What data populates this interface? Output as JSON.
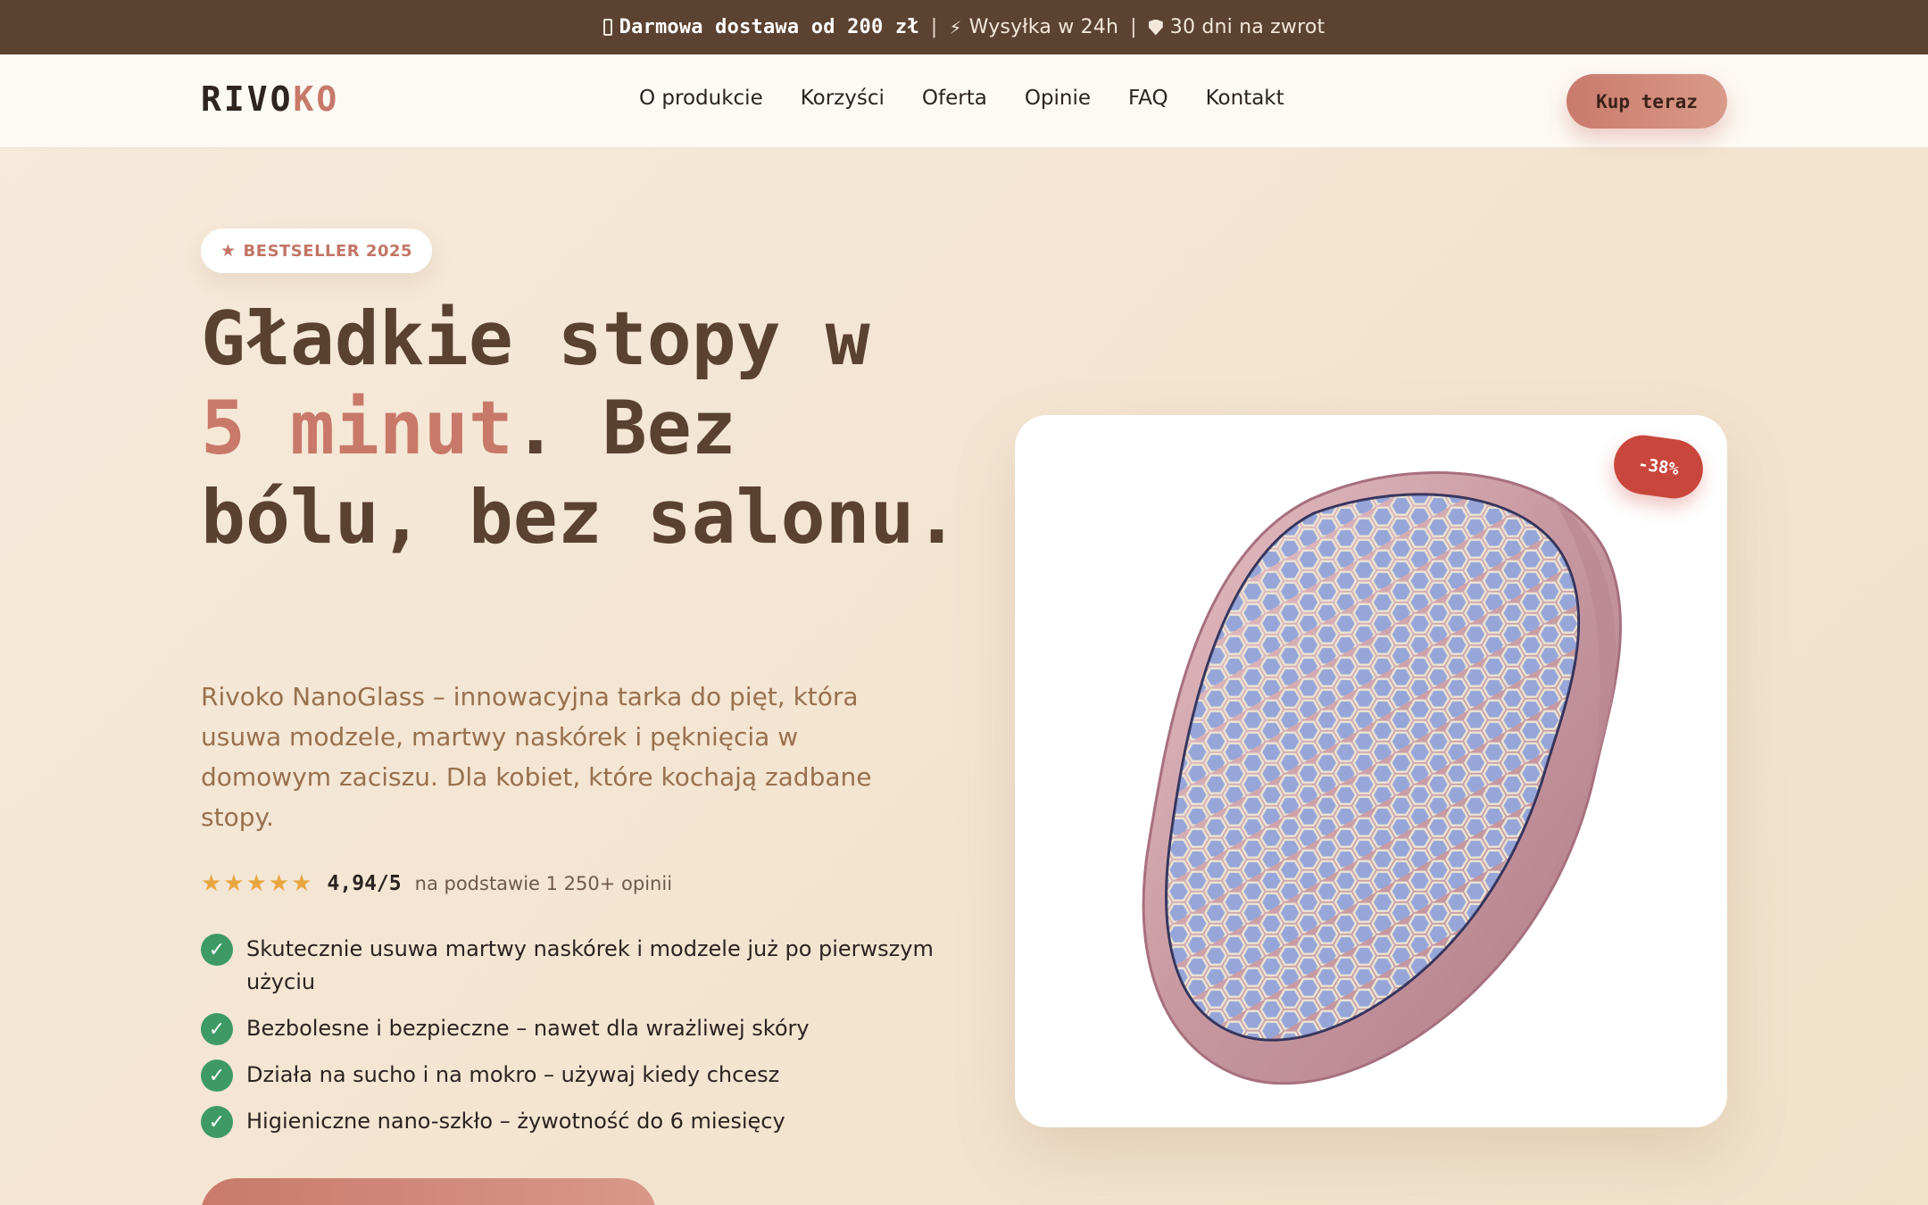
{
  "announcement": {
    "shipping_text": "Darmowa dostawa od 200 zł",
    "dispatch_text": "Wysyłka w 24h",
    "returns_text": "30 dni na zwrot",
    "separator": "|"
  },
  "header": {
    "logo_main": "RIVO",
    "logo_accent": "KO",
    "nav": [
      "O produkcie",
      "Korzyści",
      "Oferta",
      "Opinie",
      "FAQ",
      "Kontakt"
    ],
    "cta_label": "Kup teraz"
  },
  "hero": {
    "badge": "BESTSELLER 2025",
    "headline_part1": "Gładkie stopy w",
    "headline_accent": "5 minut",
    "headline_part2": ". Bez bólu, bez salonu.",
    "lead": "Rivoko NanoGlass – innowacyjna tarka do pięt, która usuwa modzele, martwy naskórek i pęknięcia w domowym zaciszu. Dla kobiet, które kochają zadbane stopy.",
    "rating_stars": "★★★★★",
    "rating_score": "4,94/5",
    "rating_count": "na podstawie 1 250+ opinii",
    "benefits": [
      "Skutecznie usuwa martwy naskórek i modzele już po pierwszym użyciu",
      "Bezbolesne i bezpieczne – nawet dla wrażliwej skóry",
      "Działa na sucho i na mokro – używaj kiedy chcesz",
      "Higieniczne nano-szkło – żywotność do 6 miesięcy"
    ],
    "check_symbol": "✓"
  },
  "product": {
    "discount_badge": "-38%"
  },
  "colors": {
    "topbar": "#5b4231",
    "accent": "#c8796a",
    "heading": "#5a4130",
    "check": "#3e9a64",
    "discount": "#c9463c"
  },
  "icons": {
    "shipping": "truck-icon",
    "dispatch": "lightning-icon",
    "returns": "shield-icon",
    "badge": "star-icon",
    "benefit": "check-icon"
  }
}
